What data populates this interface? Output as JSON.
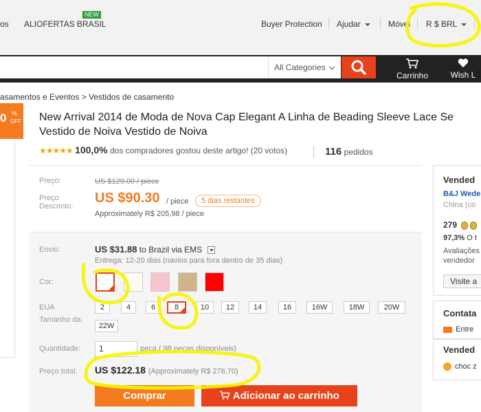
{
  "topnav": {
    "left_fragment": "os",
    "aliofertas": "ALIOFERTAS BRASIL",
    "new_badge": "NEW",
    "buyer_protection": "Buyer Protection",
    "ajudar": "Ajudar",
    "movel": "Móvel",
    "currency": "R $ BRL"
  },
  "search": {
    "category": "All Categories",
    "cart_label": "Carrinho",
    "wish_label": "Wish L"
  },
  "breadcrumb": "asamentos e Eventos > Vestidos de casamento",
  "badge": {
    "number": "0",
    "percent": "%",
    "off": "OFF"
  },
  "product": {
    "title_line1": "New Arrival 2014 de Moda de Nova Cap Elegant A Linha de Beading Sleeve Lace Se",
    "title_line2": "Vestido de Noiva Vestido de Noiva",
    "stars": "★★★★★",
    "rating_pct": "100,0%",
    "rating_text": "dos compradores gostou deste artigo! (20 votos)",
    "orders_count": "116",
    "orders_label": "pedidos"
  },
  "price": {
    "label_price": "Preço:",
    "old_price": "US $129.00 / piece",
    "label_discount_1": "Preço",
    "label_discount_2": "Desconto:",
    "new_price": "US $90.30",
    "per_piece": "/ piece",
    "days_left": "5 dias restantes",
    "approx": "Approximately R$ 205,98 / piece"
  },
  "shipping": {
    "label": "Envio:",
    "cost": "US $31.88",
    "dest": "to Brazil via EMS",
    "delivery": "Entrega: 12-20 dias (navios para fora dentro de 35 dias)"
  },
  "color": {
    "label": "Cor:",
    "swatches": [
      "#ffffff",
      "#fdfbf2",
      "#f7c4cf",
      "#d2b48c",
      "#ff0000"
    ]
  },
  "size": {
    "label_1": "EUA",
    "label_2": "Tamanho da:",
    "options": [
      "2",
      "4",
      "6",
      "8",
      "10",
      "12",
      "14",
      "16",
      "16W",
      "18W",
      "20W",
      "22W"
    ]
  },
  "quantity": {
    "label": "Quantidade:",
    "value": "1",
    "note": "peça ( 98 peças disponíveis)"
  },
  "total": {
    "label": "Preço total:",
    "value": "US $122.18",
    "approx": "(Approximately R$ 278,70)"
  },
  "buttons": {
    "buy": "Comprar",
    "add_cart": "Adicionar ao carrinho"
  },
  "seller": {
    "heading": "Vended",
    "name": "B&J Wede",
    "country": "China (co",
    "score": "279",
    "feedback_pct": "97,3%",
    "feedback_rest": "O t",
    "eval_1": "Avaliações",
    "eval_2": "vendedor",
    "visit": "Visite a",
    "contact_heading": "Contata",
    "contact_item": "Entre",
    "seller2_heading": "Vended",
    "seller2_item": "choc z"
  },
  "colors": {
    "accent_orange": "#f47b20",
    "accent_red": "#e8421c",
    "highlighter": "#f5f500"
  }
}
